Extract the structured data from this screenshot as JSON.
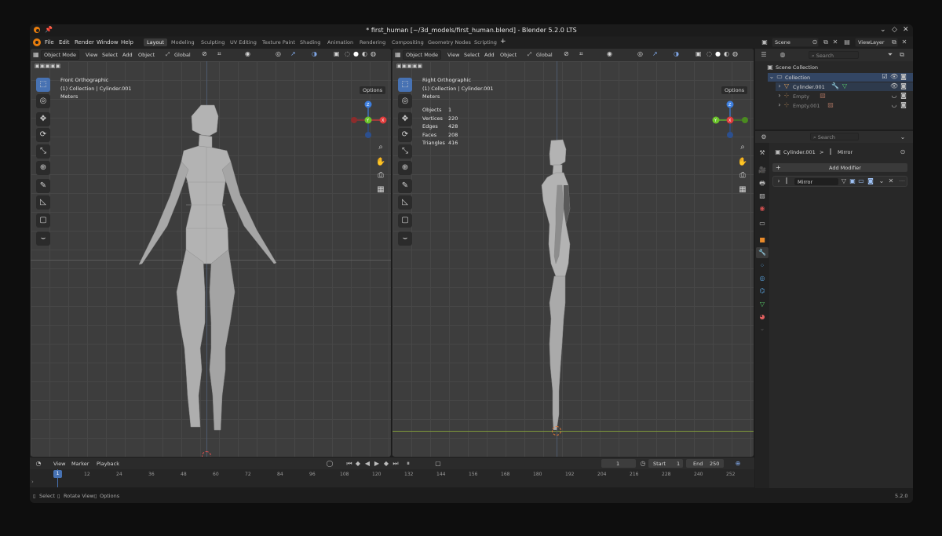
{
  "window": {
    "title": "* first_human [~/3d_models/first_human.blend] - Blender 5.2.0 LTS",
    "controls": [
      "⌄",
      "◇",
      "✕"
    ]
  },
  "menubar": {
    "menus": [
      "File",
      "Edit",
      "Render",
      "Window",
      "Help"
    ],
    "workspaces": [
      "Layout",
      "Modeling",
      "Sculpting",
      "UV Editing",
      "Texture Paint",
      "Shading",
      "Animation",
      "Rendering",
      "Compositing",
      "Geometry Nodes",
      "Scripting"
    ],
    "active_workspace": "Layout",
    "add_workspace": "+",
    "scene": "Scene",
    "view_layer": "ViewLayer"
  },
  "viewport_left": {
    "mode": "Object Mode",
    "menus": [
      "View",
      "Select",
      "Add",
      "Object"
    ],
    "orientation": "Global",
    "options": "Options",
    "overlay_lines": [
      "Front Orthographic",
      "(1) Collection | Cylinder.001",
      "Meters"
    ]
  },
  "viewport_right": {
    "mode": "Object Mode",
    "menus": [
      "View",
      "Select",
      "Add",
      "Object"
    ],
    "orientation": "Global",
    "options": "Options",
    "overlay_lines": [
      "Right Orthographic",
      "(1) Collection | Cylinder.001",
      "Meters"
    ],
    "stats": [
      {
        "label": "Objects",
        "value": "1"
      },
      {
        "label": "Vertices",
        "value": "220"
      },
      {
        "label": "Edges",
        "value": "428"
      },
      {
        "label": "Faces",
        "value": "208"
      },
      {
        "label": "Triangles",
        "value": "416"
      }
    ]
  },
  "gizmo": {
    "z": "Z",
    "y": "Y",
    "x": "X"
  },
  "outliner": {
    "search_placeholder": "Search",
    "scene_collection": "Scene Collection",
    "collection": "Collection",
    "objects": [
      {
        "name": "Cylinder.001",
        "color": "#e0a05a"
      },
      {
        "name": "Empty",
        "color": "#7a7a7a"
      },
      {
        "name": "Empty.001",
        "color": "#7a7a7a"
      }
    ]
  },
  "properties": {
    "search_placeholder": "Search",
    "breadcrumb_object": "Cylinder.001",
    "breadcrumb_sep": ">",
    "breadcrumb_modifier": "Mirror",
    "add_modifier": "Add Modifier",
    "modifier_name": "Mirror"
  },
  "timeline": {
    "menus": [
      "View",
      "Marker",
      "Playback"
    ],
    "current_frame": "1",
    "start_label": "Start",
    "start": "1",
    "end_label": "End",
    "end": "250",
    "ticks": [
      "1",
      "12",
      "24",
      "36",
      "48",
      "60",
      "72",
      "84",
      "96",
      "108",
      "120",
      "132",
      "144",
      "156",
      "168",
      "180",
      "192",
      "204",
      "216",
      "228",
      "240",
      "252"
    ]
  },
  "statusbar": {
    "items": [
      "Select",
      "Rotate View",
      "Options"
    ],
    "version": "5.2.0"
  },
  "colors": {
    "accent": "#4772b3",
    "x_axis": "#e03b3b",
    "y_axis": "#6bc42a",
    "z_axis": "#3d7ede",
    "mesh": "#b9b9b9"
  }
}
